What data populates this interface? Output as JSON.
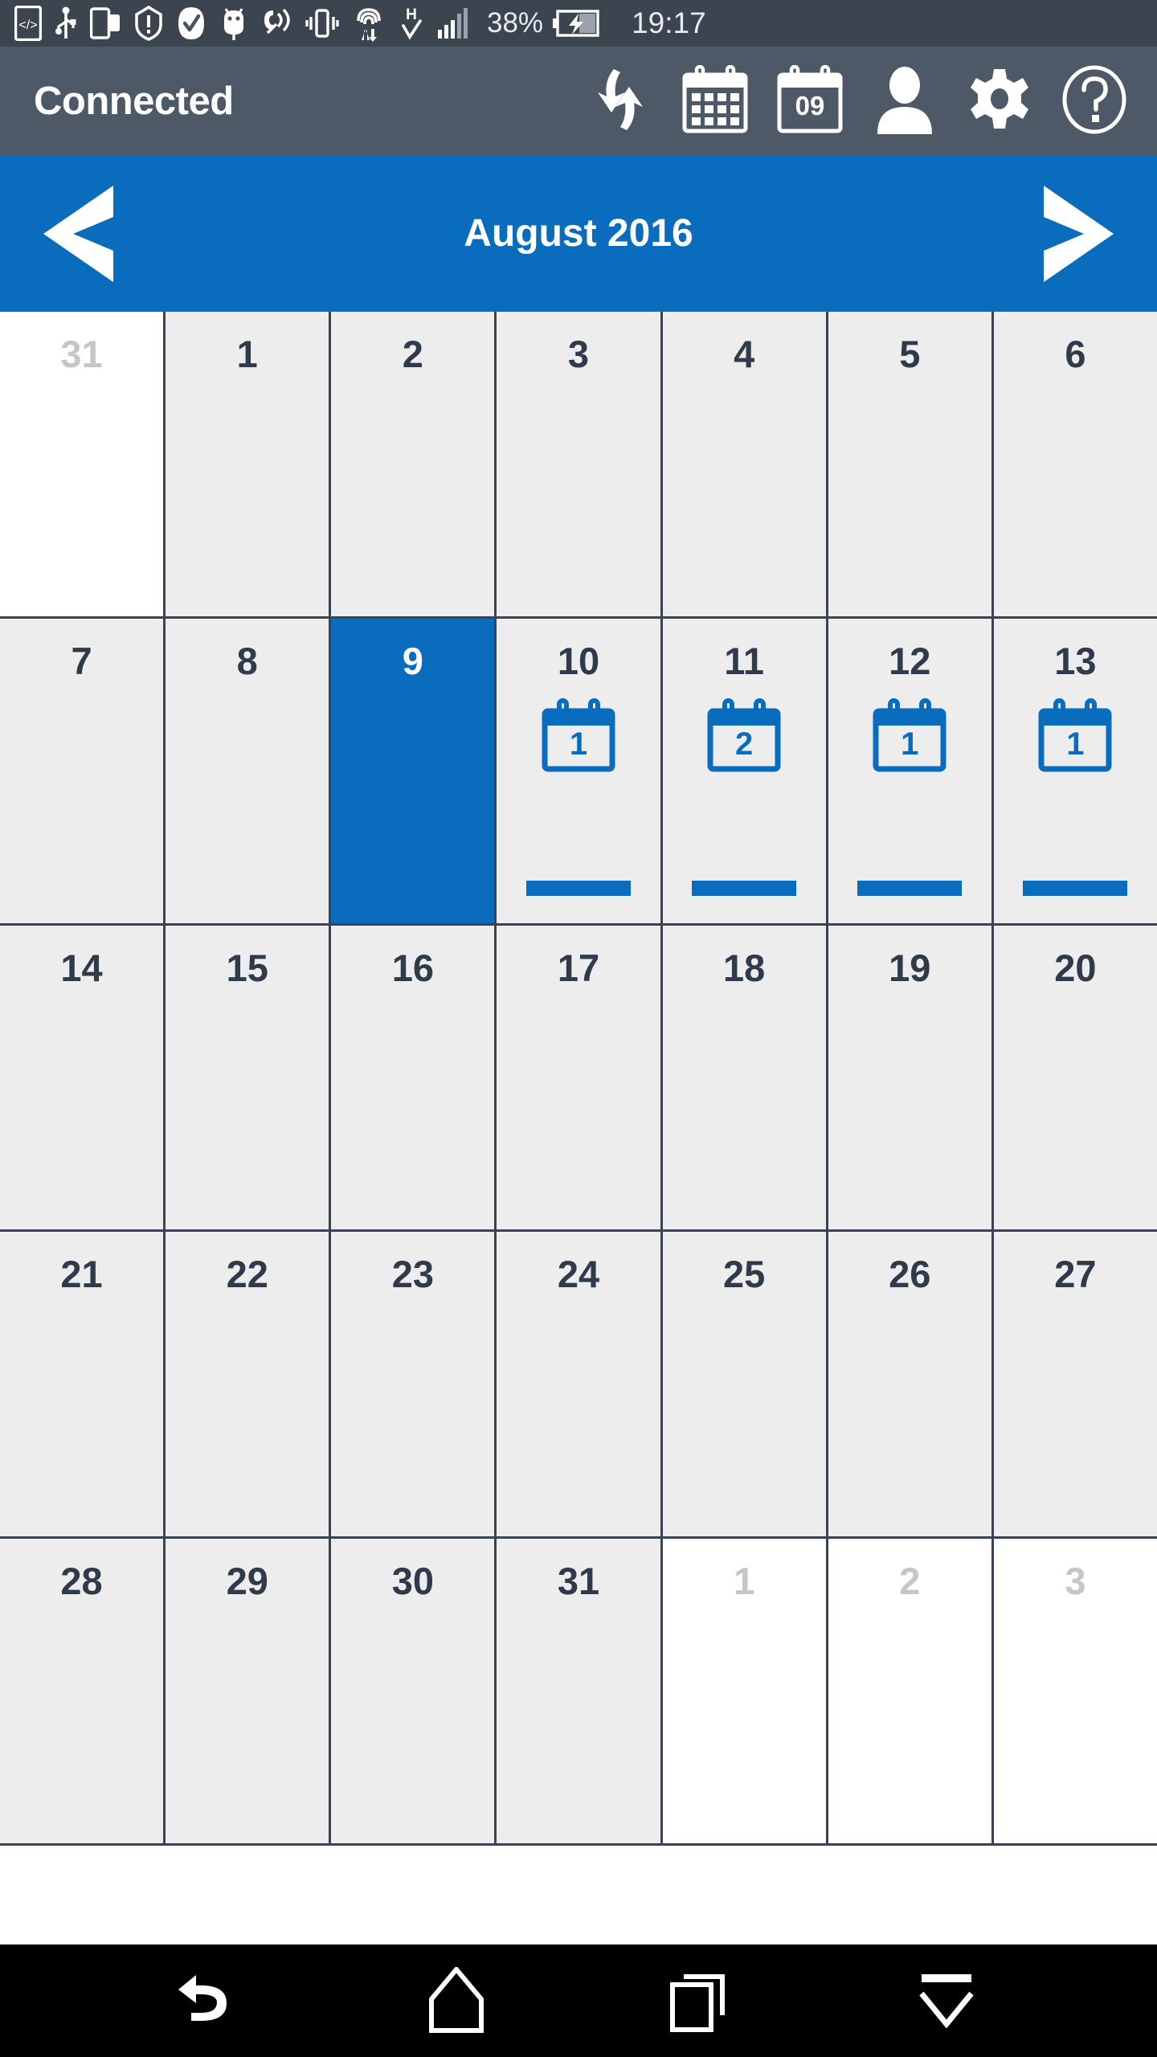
{
  "status_bar": {
    "battery_percent": "38%",
    "time": "19:17",
    "icons": [
      "developer-mode-icon",
      "usb-debugging-icon",
      "screen-cast-icon",
      "warning-shield-icon",
      "check-circle-icon",
      "android-bug-icon",
      "vibrate-ring-icon",
      "vibrate-icon",
      "data-transfer-icon",
      "hspa-network-icon",
      "signal-bars-icon",
      "battery-charging-icon"
    ]
  },
  "header": {
    "title": "Connected",
    "actions": [
      {
        "name": "sync-icon",
        "label": "Sync"
      },
      {
        "name": "calendar-month-icon",
        "label": "Month view"
      },
      {
        "name": "calendar-day-icon",
        "label": "Day view",
        "day_number": "09"
      },
      {
        "name": "person-icon",
        "label": "Profile"
      },
      {
        "name": "gear-icon",
        "label": "Settings"
      },
      {
        "name": "help-icon",
        "label": "Help"
      }
    ]
  },
  "month_nav": {
    "prev_label": "<",
    "next_label": ">",
    "month_title": "August 2016"
  },
  "calendar": {
    "weeks": [
      [
        {
          "day": "31",
          "other_month": true,
          "selected": false,
          "events": null
        },
        {
          "day": "1",
          "other_month": false,
          "selected": false,
          "events": null
        },
        {
          "day": "2",
          "other_month": false,
          "selected": false,
          "events": null
        },
        {
          "day": "3",
          "other_month": false,
          "selected": false,
          "events": null
        },
        {
          "day": "4",
          "other_month": false,
          "selected": false,
          "events": null
        },
        {
          "day": "5",
          "other_month": false,
          "selected": false,
          "events": null
        },
        {
          "day": "6",
          "other_month": false,
          "selected": false,
          "events": null
        }
      ],
      [
        {
          "day": "7",
          "other_month": false,
          "selected": false,
          "events": null
        },
        {
          "day": "8",
          "other_month": false,
          "selected": false,
          "events": null
        },
        {
          "day": "9",
          "other_month": false,
          "selected": true,
          "events": null
        },
        {
          "day": "10",
          "other_month": false,
          "selected": false,
          "events": "1"
        },
        {
          "day": "11",
          "other_month": false,
          "selected": false,
          "events": "2"
        },
        {
          "day": "12",
          "other_month": false,
          "selected": false,
          "events": "1"
        },
        {
          "day": "13",
          "other_month": false,
          "selected": false,
          "events": "1"
        }
      ],
      [
        {
          "day": "14",
          "other_month": false,
          "selected": false,
          "events": null
        },
        {
          "day": "15",
          "other_month": false,
          "selected": false,
          "events": null
        },
        {
          "day": "16",
          "other_month": false,
          "selected": false,
          "events": null
        },
        {
          "day": "17",
          "other_month": false,
          "selected": false,
          "events": null
        },
        {
          "day": "18",
          "other_month": false,
          "selected": false,
          "events": null
        },
        {
          "day": "19",
          "other_month": false,
          "selected": false,
          "events": null
        },
        {
          "day": "20",
          "other_month": false,
          "selected": false,
          "events": null
        }
      ],
      [
        {
          "day": "21",
          "other_month": false,
          "selected": false,
          "events": null
        },
        {
          "day": "22",
          "other_month": false,
          "selected": false,
          "events": null
        },
        {
          "day": "23",
          "other_month": false,
          "selected": false,
          "events": null
        },
        {
          "day": "24",
          "other_month": false,
          "selected": false,
          "events": null
        },
        {
          "day": "25",
          "other_month": false,
          "selected": false,
          "events": null
        },
        {
          "day": "26",
          "other_month": false,
          "selected": false,
          "events": null
        },
        {
          "day": "27",
          "other_month": false,
          "selected": false,
          "events": null
        }
      ],
      [
        {
          "day": "28",
          "other_month": false,
          "selected": false,
          "events": null
        },
        {
          "day": "29",
          "other_month": false,
          "selected": false,
          "events": null
        },
        {
          "day": "30",
          "other_month": false,
          "selected": false,
          "events": null
        },
        {
          "day": "31",
          "other_month": false,
          "selected": false,
          "events": null
        },
        {
          "day": "1",
          "other_month": true,
          "selected": false,
          "events": null
        },
        {
          "day": "2",
          "other_month": true,
          "selected": false,
          "events": null
        },
        {
          "day": "3",
          "other_month": true,
          "selected": false,
          "events": null
        }
      ]
    ]
  },
  "nav_bar": {
    "buttons": [
      {
        "name": "back-icon",
        "label": "Back"
      },
      {
        "name": "home-icon",
        "label": "Home"
      },
      {
        "name": "recents-icon",
        "label": "Recent apps"
      },
      {
        "name": "hide-keyboard-icon",
        "label": "Hide"
      }
    ]
  },
  "colors": {
    "accent_blue": "#0a6cbd",
    "header_gray": "#4e5967",
    "status_gray": "#3c4450",
    "cell_gray": "#ededed",
    "grid_line": "#3a4354",
    "text_dark": "#2f3a4a",
    "text_muted": "#c6c6c6"
  }
}
